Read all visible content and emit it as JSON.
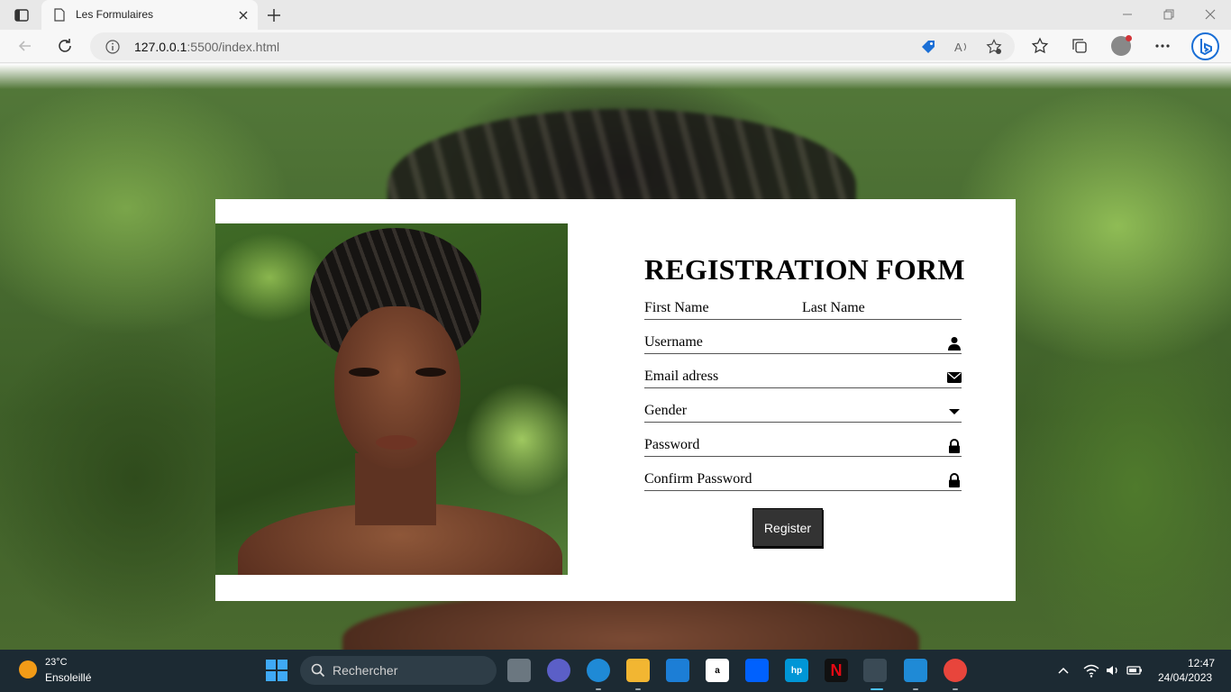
{
  "browser": {
    "tab_title": "Les Formulaires",
    "url_host": "127.0.0.1",
    "url_path": ":5500/index.html"
  },
  "page": {
    "form_title": "REGISTRATION FORM",
    "fields": {
      "first_name": "First Name",
      "last_name": "Last Name",
      "username": "Username",
      "email": "Email adress",
      "gender": "Gender",
      "password": "Password",
      "confirm_password": "Confirm Password"
    },
    "register_label": "Register"
  },
  "taskbar": {
    "weather_temp": "23°C",
    "weather_desc": "Ensoleillé",
    "search_placeholder": "Rechercher",
    "time": "12:47",
    "date": "24/04/2023",
    "apps": [
      "file-explorer",
      "teams",
      "edge",
      "folder",
      "mail",
      "amazon",
      "dropbox",
      "myhp",
      "netflix",
      "snipping-tool",
      "vscode",
      "chrome"
    ]
  },
  "colors": {
    "accent_blue": "#1a6fd6",
    "button_bg": "#333333",
    "taskbar_bg": "#1c2a33"
  }
}
